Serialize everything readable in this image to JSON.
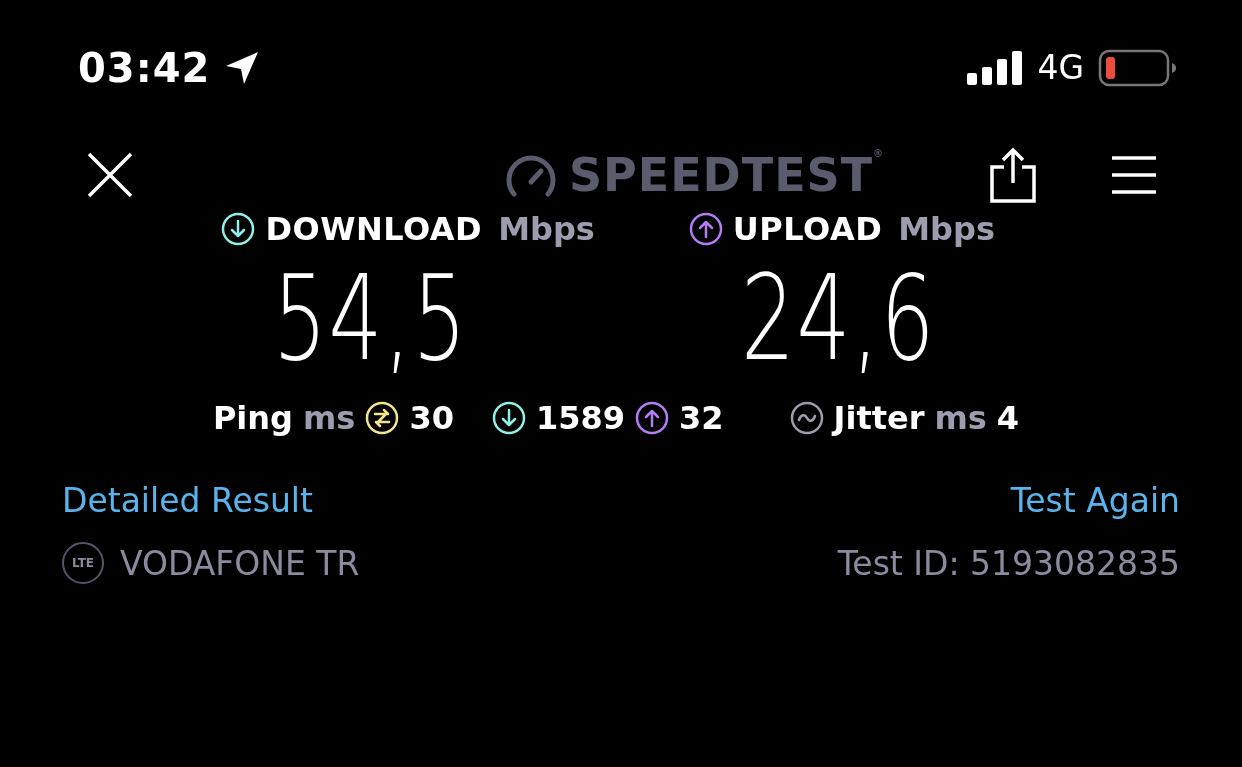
{
  "status_bar": {
    "time": "03:42",
    "network": "4G"
  },
  "header": {
    "logo": "SPEEDTEST$^{®}$"
  },
  "results": [
    {
      "kind": "download",
      "label": "DOWNLOAD",
      "unit": "Mbps",
      "value": "54,5"
    },
    {
      "kind": "upload",
      "label": "UPLOAD",
      "unit": "Mbps",
      "value": "24,6"
    }
  ],
  "stats": {
    "ping_label": "Ping",
    "ping_unit": "ms",
    "ping": "30",
    "ping_download": "1589",
    "ping_upload": "32",
    "jitter_label": "Jitter",
    "jitter_unit": "ms",
    "jitter": "4"
  },
  "links": {
    "detailed": "Detailed Result",
    "again": "Test Again"
  },
  "provider": {
    "badge": "LTE",
    "name": "VODAFONE TR",
    "test_id": "Test ID: 5193082835"
  }
}
